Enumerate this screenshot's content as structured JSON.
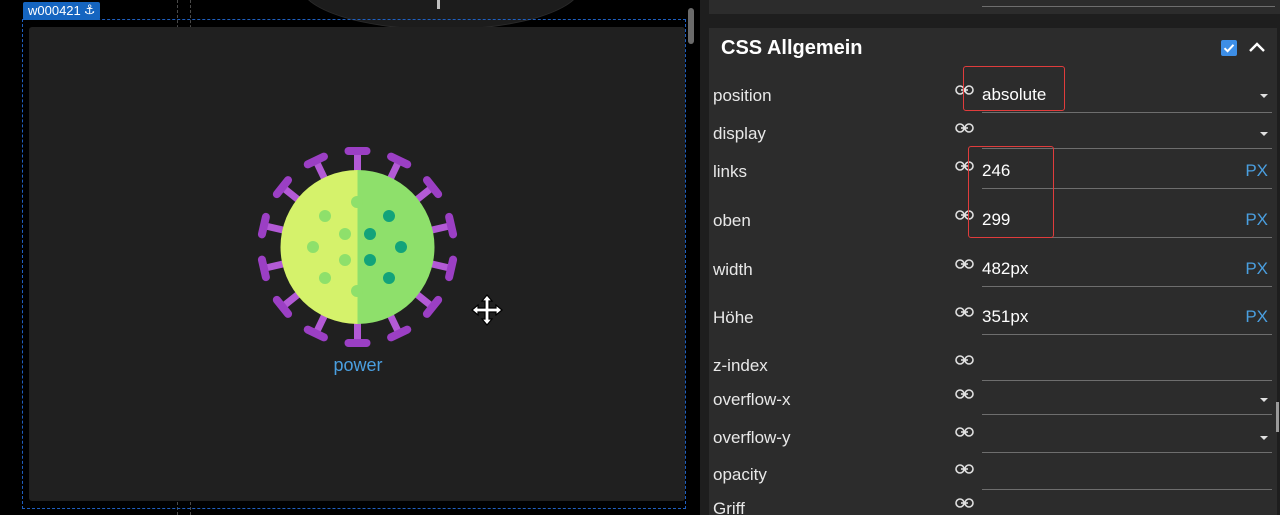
{
  "canvas": {
    "widget_id": "w000421",
    "widget_label": "power"
  },
  "panel": {
    "section": {
      "title": "CSS Allgemein",
      "enabled": true,
      "rows": [
        {
          "label": "position",
          "value": "absolute",
          "unit": "",
          "dropdown": true
        },
        {
          "label": "display",
          "value": "",
          "unit": "",
          "dropdown": true
        },
        {
          "label": "links",
          "value": "246",
          "unit": "PX",
          "dropdown": false
        },
        {
          "label": "oben",
          "value": "299",
          "unit": "PX",
          "dropdown": false
        },
        {
          "label": "width",
          "value": "482px",
          "unit": "PX",
          "dropdown": false
        },
        {
          "label": "Höhe",
          "value": "351px",
          "unit": "PX",
          "dropdown": false
        },
        {
          "label": "z-index",
          "value": "",
          "unit": "",
          "dropdown": false
        },
        {
          "label": "overflow-x",
          "value": "",
          "unit": "",
          "dropdown": true
        },
        {
          "label": "overflow-y",
          "value": "",
          "unit": "",
          "dropdown": true
        },
        {
          "label": "opacity",
          "value": "",
          "unit": "",
          "dropdown": false
        },
        {
          "label": "Griff",
          "value": "",
          "unit": "",
          "dropdown": false
        }
      ]
    }
  },
  "colors": {
    "accent_blue": "#3d8ee6",
    "unit_blue": "#4a9fe0",
    "highlight_red": "#e03c3c",
    "virus_light": "#d5f26b",
    "virus_dark": "#8ee06b",
    "spike_purple": "#b35ad6"
  }
}
